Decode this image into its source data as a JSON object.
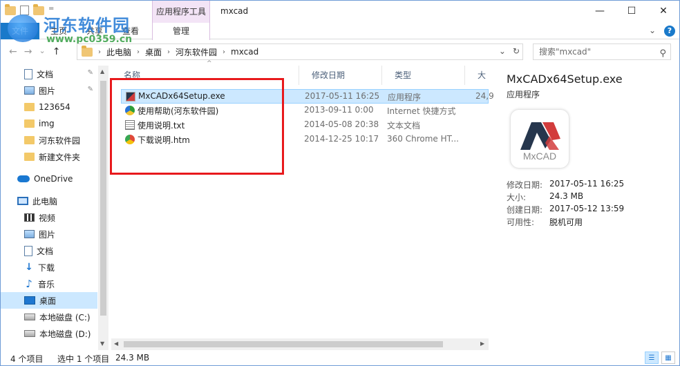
{
  "window": {
    "context_tab": "应用程序工具",
    "title": "mxcad",
    "minimize": "—",
    "maximize": "☐",
    "close": "✕"
  },
  "ribbon": {
    "file_tab": "文件",
    "tabs": [
      "主页",
      "共享",
      "查看"
    ],
    "manage_tab": "管理",
    "collapse": "⌄",
    "help": "?"
  },
  "watermark": {
    "text": "河东软件园",
    "url": "www.pc0359.cn"
  },
  "address": {
    "back": "←",
    "forward": "→",
    "recent": "⌄",
    "up": "↑",
    "crumbs": [
      "此电脑",
      "桌面",
      "河东软件园",
      "mxcad"
    ],
    "dropdown": "⌄",
    "refresh": "↻",
    "search_placeholder": "搜索\"mxcad\"",
    "search_icon": "⚲"
  },
  "sidebar": {
    "items": [
      {
        "label": "文档",
        "icon": "document-icon",
        "pinned": true
      },
      {
        "label": "图片",
        "icon": "picture-icon",
        "pinned": true
      },
      {
        "label": "123654",
        "icon": "folder-icon"
      },
      {
        "label": "img",
        "icon": "folder-icon"
      },
      {
        "label": "河东软件园",
        "icon": "folder-icon"
      },
      {
        "label": "新建文件夹",
        "icon": "folder-icon"
      },
      {
        "label": "OneDrive",
        "icon": "cloud-icon"
      },
      {
        "label": "此电脑",
        "icon": "computer-icon"
      },
      {
        "label": "视频",
        "icon": "video-icon"
      },
      {
        "label": "图片",
        "icon": "picture-icon"
      },
      {
        "label": "文档",
        "icon": "document-icon"
      },
      {
        "label": "下载",
        "icon": "download-icon"
      },
      {
        "label": "音乐",
        "icon": "music-icon"
      },
      {
        "label": "桌面",
        "icon": "desktop-icon",
        "selected": true
      },
      {
        "label": "本地磁盘 (C:)",
        "icon": "drive-icon"
      },
      {
        "label": "本地磁盘 (D:)",
        "icon": "drive-icon"
      }
    ],
    "pin_glyph": "📌",
    "scroll_up": "▲",
    "scroll_down": "▼"
  },
  "file_list": {
    "columns": {
      "name": "名称",
      "date": "修改日期",
      "type": "类型",
      "size": "大小"
    },
    "sort_glyph": "^",
    "rows": [
      {
        "name": "MxCADx64Setup.exe",
        "date": "2017-05-11 16:25",
        "type": "应用程序",
        "size": "24,9",
        "icon": "mxcad-exe-icon",
        "selected": true
      },
      {
        "name": "使用帮助(河东软件园)",
        "date": "2013-09-11 0:00",
        "type": "Internet 快捷方式",
        "size": "",
        "icon": "internet-shortcut-icon"
      },
      {
        "name": "使用说明.txt",
        "date": "2014-05-08 20:38",
        "type": "文本文档",
        "size": "",
        "icon": "text-file-icon"
      },
      {
        "name": "下载说明.htm",
        "date": "2014-12-25 10:17",
        "type": "360 Chrome HT...",
        "size": "",
        "icon": "chrome-html-icon"
      }
    ],
    "hscroll_left": "◀",
    "hscroll_right": "▶"
  },
  "details": {
    "name": "MxCADx64Setup.exe",
    "type": "应用程序",
    "thumb_text": "MxCAD",
    "props": [
      {
        "key": "修改日期:",
        "value": "2017-05-11 16:25"
      },
      {
        "key": "大小:",
        "value": "24.3 MB"
      },
      {
        "key": "创建日期:",
        "value": "2017-05-12 13:59"
      },
      {
        "key": "可用性:",
        "value": "脱机可用"
      }
    ]
  },
  "status": {
    "count": "4 个项目",
    "selection": "选中 1 个项目",
    "size": "24.3 MB",
    "details_view": "☰",
    "icons_view": "▦"
  },
  "colors": {
    "accent": "#1979ca",
    "selection": "#cce8ff",
    "context_tab": "#f3e4f6",
    "highlight_box": "#e8191c"
  }
}
